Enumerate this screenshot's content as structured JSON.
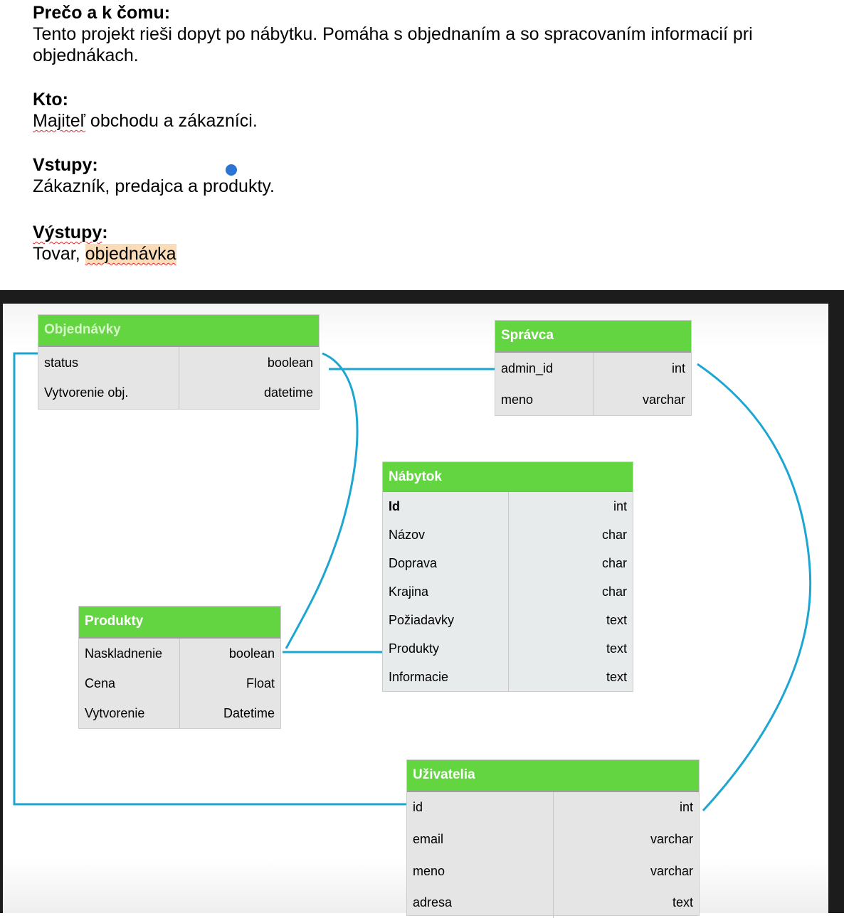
{
  "document": {
    "sections": [
      {
        "heading": "Prečo a k čomu:",
        "body": "Tento projekt rieši dopyt po nábytku. Pomáha s objednaním a so spracovaním informacií pri objednákach."
      },
      {
        "heading": "Kto:",
        "body_flagged": "Majiteľ",
        "body_rest": " obchodu a zákazníci."
      },
      {
        "heading": "Vstupy:",
        "body": "Zákazník, predajca a produkty."
      },
      {
        "heading_flagged": "Výstupy",
        "heading_rest": ":",
        "body_prefix": "Tovar, ",
        "body_highlight": "objednávka"
      }
    ]
  },
  "diagram": {
    "line_color": "#1ea6d2",
    "header_color": "#63d541",
    "entities": {
      "objednavky": {
        "title": "Objednávky",
        "fields": [
          {
            "name": "status",
            "type": "boolean"
          },
          {
            "name": "Vytvorenie obj.",
            "type": "datetime"
          }
        ]
      },
      "spravca": {
        "title": "Správca",
        "fields": [
          {
            "name": "admin_id",
            "type": "int"
          },
          {
            "name": "meno",
            "type": "varchar"
          }
        ]
      },
      "nabytok": {
        "title": "Nábytok",
        "fields": [
          {
            "name": "Id",
            "type": "int"
          },
          {
            "name": "Názov",
            "type": "char"
          },
          {
            "name": "Doprava",
            "type": "char"
          },
          {
            "name": "Krajina",
            "type": "char"
          },
          {
            "name": "Požiadavky",
            "type": "text"
          },
          {
            "name": "Produkty",
            "type": "text"
          },
          {
            "name": "Informacie",
            "type": "text"
          }
        ]
      },
      "produkty": {
        "title": "Produkty",
        "fields": [
          {
            "name": "Naskladnenie",
            "type": "boolean"
          },
          {
            "name": "Cena",
            "type": "Float"
          },
          {
            "name": "Vytvorenie",
            "type": "Datetime"
          }
        ]
      },
      "uzivatelia": {
        "title": "Uživatelia",
        "fields": [
          {
            "name": "id",
            "type": "int"
          },
          {
            "name": "email",
            "type": "varchar"
          },
          {
            "name": "meno",
            "type": "varchar"
          },
          {
            "name": "adresa",
            "type": "text"
          }
        ]
      }
    }
  }
}
